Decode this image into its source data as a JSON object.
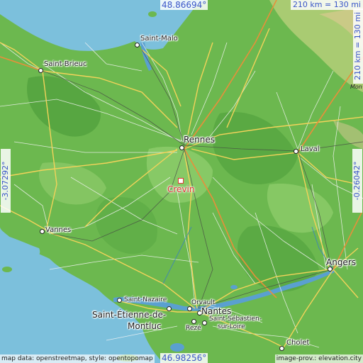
{
  "map": {
    "target": {
      "name": "Crevin"
    },
    "coordinates": {
      "top_lat": "48.86694°",
      "bottom_lat": "46.98256°",
      "left_lon": "-3.07292°",
      "right_lon": "-0.26042°"
    },
    "scale": {
      "top": "210 km = 130 mi",
      "right": "210 km = 130 mi"
    },
    "credits": {
      "left": "map data: openstreetmap, style: opentopomap",
      "right": "image-prov.: elevation.city"
    },
    "partial_label": "Mon",
    "cities": [
      {
        "key": "saint_malo",
        "name": "Saint-Malo"
      },
      {
        "key": "saint_brieuc",
        "name": "Saint-Brieuc"
      },
      {
        "key": "rennes",
        "name": "Rennes"
      },
      {
        "key": "laval",
        "name": "Laval"
      },
      {
        "key": "vannes",
        "name": "Vannes"
      },
      {
        "key": "angers",
        "name": "Angers"
      },
      {
        "key": "saint_nazaire",
        "name": "Saint-Nazaire"
      },
      {
        "key": "saint_etienne",
        "name": "Saint-Étienne-de-"
      },
      {
        "key": "montluc",
        "name": "Montluc"
      },
      {
        "key": "orvault",
        "name": "Orvault"
      },
      {
        "key": "nantes",
        "name": "Nantes"
      },
      {
        "key": "reze",
        "name": "Rezé"
      },
      {
        "key": "saint_sebastien",
        "name": "Saint-Sébastien-"
      },
      {
        "key": "sur_loire",
        "name": "sur-Loire"
      },
      {
        "key": "cholet",
        "name": "Cholet"
      }
    ]
  }
}
